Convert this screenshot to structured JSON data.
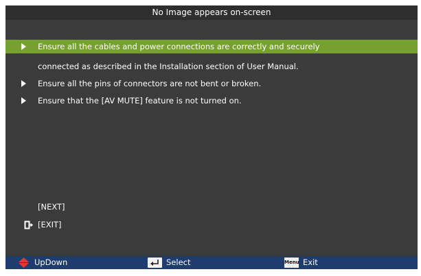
{
  "window": {
    "title": "No Image appears on-screen"
  },
  "items": [
    {
      "text": "Ensure all the cables and power connections are correctly and securely",
      "bullet": true,
      "selected": true
    },
    {
      "text": "connected as described in the Installation section of User Manual.",
      "bullet": false,
      "selected": false
    },
    {
      "text": "Ensure all the pins of connectors are not bent or broken.",
      "bullet": true,
      "selected": false
    },
    {
      "text": "Ensure that the [AV MUTE] feature is not turned on.",
      "bullet": true,
      "selected": false
    }
  ],
  "nav": {
    "next_label": "[NEXT]",
    "exit_label": "[EXIT]",
    "exit_icon": "exit-door-icon"
  },
  "footer": {
    "updown_label": "UpDown",
    "updown_icon": "up-down-arrows-icon",
    "select_label": "Select",
    "select_icon": "enter-key-icon",
    "exit_label": "Exit",
    "exit_icon": "menu-key-icon",
    "exit_icon_text": "Menu"
  },
  "colors": {
    "background": "#3b3b3b",
    "title_bar": "#2e2e2e",
    "selected_row": "#76a030",
    "footer_bar": "#1e3d6e",
    "updown_icon": "#e8362f"
  }
}
